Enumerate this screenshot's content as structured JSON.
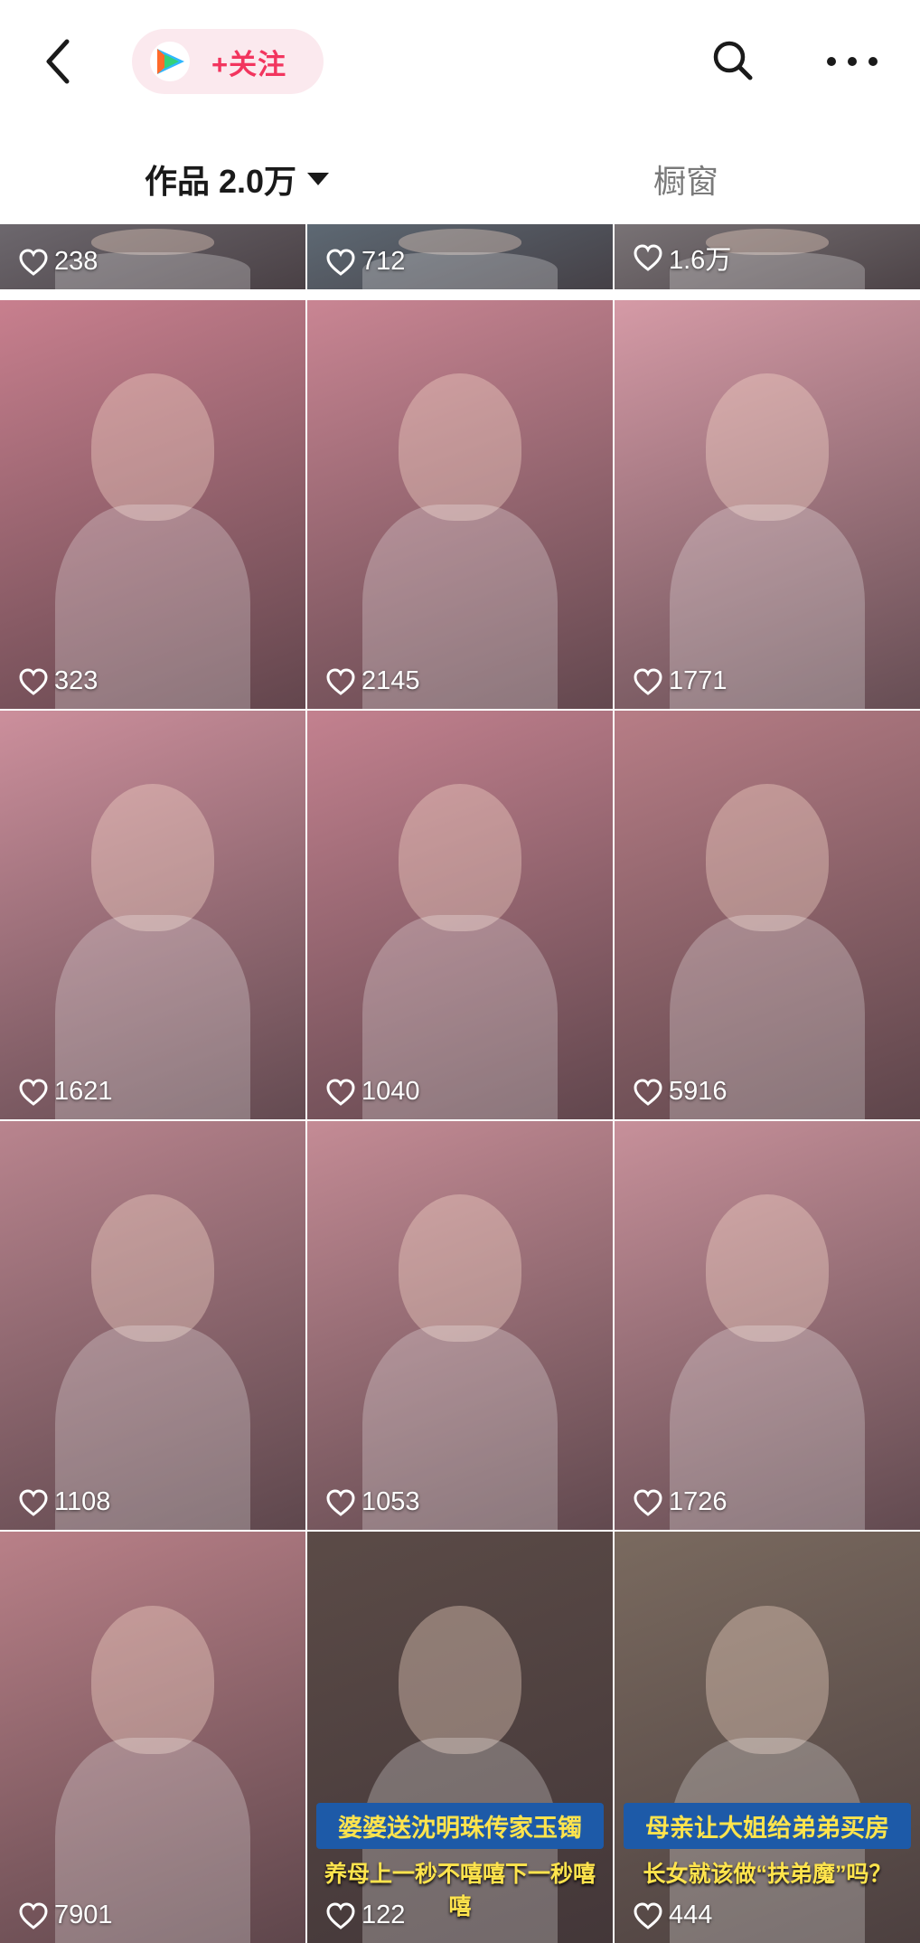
{
  "header": {
    "follow_label": "+关注",
    "back_icon": "chevron-left-icon",
    "search_icon": "search-icon",
    "more_icon": "more-horizontal-icon",
    "accent_color": "#f2355e"
  },
  "tabs": {
    "works_label": "作品 2.0万",
    "shop_label": "橱窗"
  },
  "videos": [
    {
      "likes": "238",
      "overlay_text": "",
      "bg": "#6f6a70"
    },
    {
      "likes": "712",
      "overlay_text": "",
      "bg": "#5f6b76"
    },
    {
      "likes": "1.6万",
      "overlay_text": "",
      "bg": "#7b7578"
    },
    {
      "likes": "323",
      "overlay_text": "",
      "bg": "#c87f8e"
    },
    {
      "likes": "2145",
      "overlay_text": "",
      "bg": "#c98593"
    },
    {
      "likes": "1771",
      "overlay_text": "",
      "bg": "#d59aa6"
    },
    {
      "likes": "1621",
      "overlay_text": "",
      "bg": "#cc8f9c"
    },
    {
      "likes": "1040",
      "overlay_text": "",
      "bg": "#c3818f"
    },
    {
      "likes": "5916",
      "overlay_text": "",
      "bg": "#b77d86"
    },
    {
      "likes": "1108",
      "overlay_text": "",
      "bg": "#b9848e"
    },
    {
      "likes": "1053",
      "overlay_text": "",
      "bg": "#c48b95"
    },
    {
      "likes": "1726",
      "overlay_text": "",
      "bg": "#c7909a"
    },
    {
      "likes": "7901",
      "overlay_text": "",
      "bg": "#b98088"
    },
    {
      "likes": "122",
      "overlay_text": "婆婆送沈明珠传家玉镯",
      "overlay_sub": "养母上一秒不嘻嘻下一秒嘻嘻",
      "bg": "#5b4b47"
    },
    {
      "likes": "444",
      "overlay_text": "母亲让大姐给弟弟买房",
      "overlay_sub": "长女就该做“扶弟魔”吗？",
      "bg": "#7a6a5f"
    }
  ]
}
